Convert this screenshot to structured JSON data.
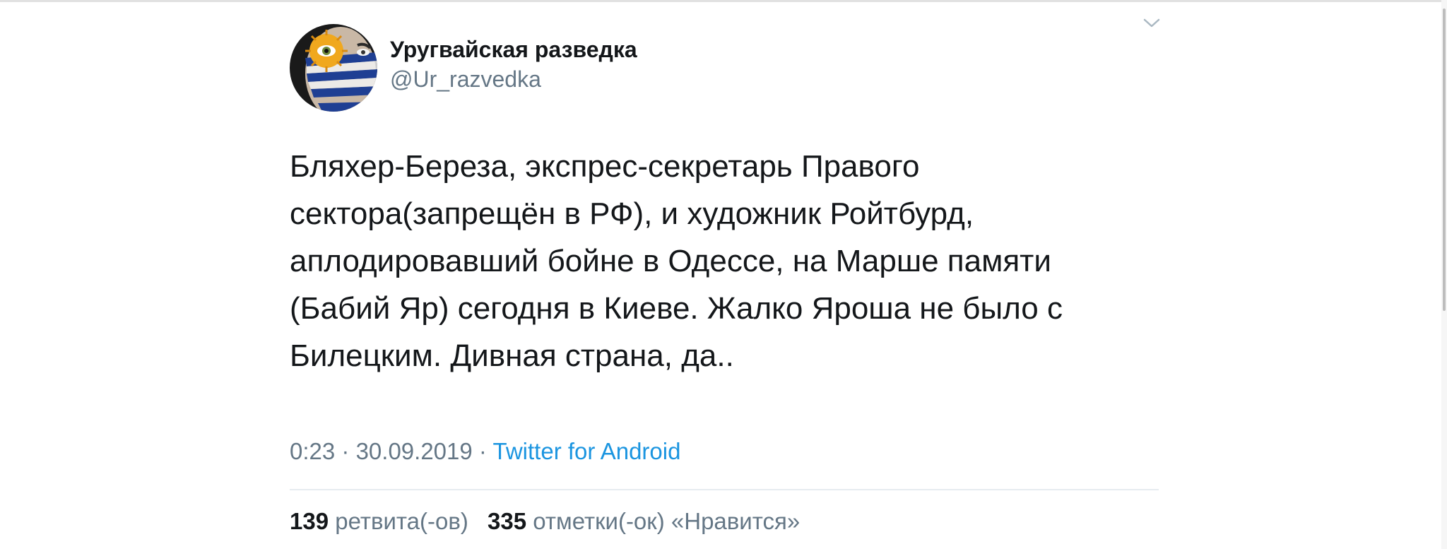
{
  "author": {
    "name": "Уругвайская разведка",
    "handle": "@Ur_razvedka"
  },
  "tweet": {
    "lines": [
      "Бляхер-Береза, экспрес-секретарь Правого",
      "сектора(запрещён в РФ), и художник Ройтбурд,",
      "аплодировавший бойне в Одессе, на Марше памяти",
      "(Бабий Яр) сегодня в Киеве. Жалко Яроша не было с",
      "Билецким. Дивная страна, да.."
    ],
    "time": "0:23",
    "separator": "·",
    "date": "30.09.2019",
    "source": "Twitter for Android"
  },
  "stats": {
    "retweets_count": "139",
    "retweets_label": "ретвита(-ов)",
    "likes_count": "335",
    "likes_label": "отметки(-ок) «Нравится»"
  },
  "colors": {
    "text": "#14171a",
    "secondary": "#657786",
    "link": "#1b95e0",
    "divider": "#e6ecf0"
  },
  "icons": {
    "menu": "chevron-down-icon",
    "avatar": "uruguay-face-paint"
  }
}
